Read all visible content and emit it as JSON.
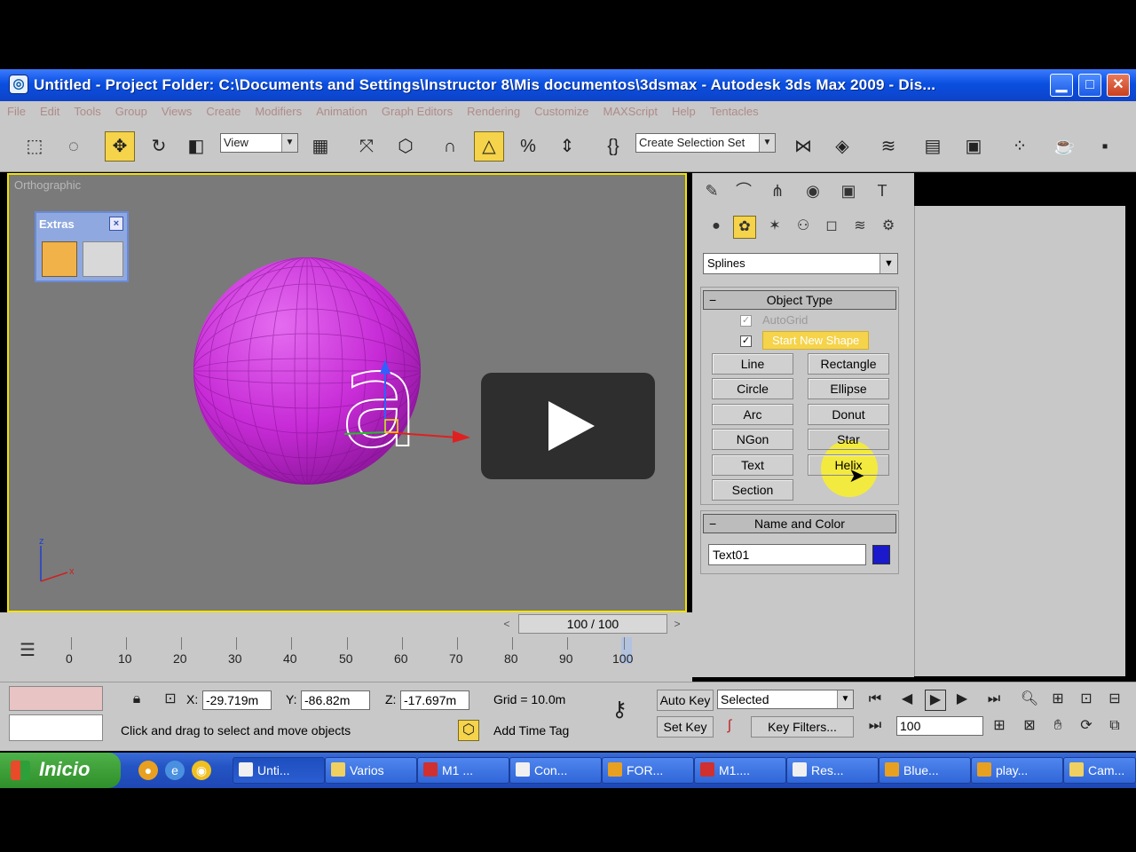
{
  "window": {
    "title": "Untitled    - Project Folder: C:\\Documents and Settings\\Instructor 8\\Mis documentos\\3dsmax    - Autodesk 3ds Max  2009     - Dis...",
    "buttons": [
      "minimize",
      "maximize",
      "close"
    ]
  },
  "menu": [
    "File",
    "Edit",
    "Tools",
    "Group",
    "Views",
    "Create",
    "Modifiers",
    "Animation",
    "Graph Editors",
    "Rendering",
    "Customize",
    "MAXScript",
    "Help",
    "Tentacles"
  ],
  "toolbar": {
    "view_combo": "View",
    "selection_set_combo": "Create Selection Set"
  },
  "viewport": {
    "label": "Orthographic",
    "axis_x": "x",
    "axis_z": "z"
  },
  "extras": {
    "title": "Extras",
    "close": "×"
  },
  "command_panel": {
    "category": "Splines",
    "object_type_title": "Object Type",
    "autogrid_label": "AutoGrid",
    "start_new_shape_label": "Start New Shape",
    "buttons": [
      "Line",
      "Rectangle",
      "Circle",
      "Ellipse",
      "Arc",
      "Donut",
      "NGon",
      "Star",
      "Text",
      "Helix",
      "Section"
    ],
    "name_and_color_title": "Name and Color",
    "object_name": "Text01",
    "object_color": "#1a1acc"
  },
  "time": {
    "frame_display": "100 / 100",
    "ticks": [
      "0",
      "10",
      "20",
      "30",
      "40",
      "50",
      "60",
      "70",
      "80",
      "90",
      "100"
    ]
  },
  "status": {
    "x_label": "X:",
    "x_value": "-29.719m",
    "y_label": "Y:",
    "y_value": "-86.82m",
    "z_label": "Z:",
    "z_value": "-17.697m",
    "grid": "Grid = 10.0m",
    "prompt": "Click and drag to select and move objects",
    "add_time_tag": "Add Time Tag",
    "auto_key": "Auto Key",
    "set_key": "Set Key",
    "selected_combo": "Selected",
    "key_filters": "Key Filters...",
    "frame_field": "100"
  },
  "taskbar": {
    "start_label": "Inicio",
    "tasks": [
      "Unti...",
      "Varios",
      "M1 ...",
      "Con...",
      "FOR...",
      "M1....",
      "Res...",
      "Blue...",
      "play...",
      "Cam..."
    ]
  },
  "colors": {
    "sphere": "#c72bd6",
    "accent_yellow": "#f5d34a",
    "viewport_bg": "#7a7a7a",
    "titlebar": "#0a4fe0"
  }
}
